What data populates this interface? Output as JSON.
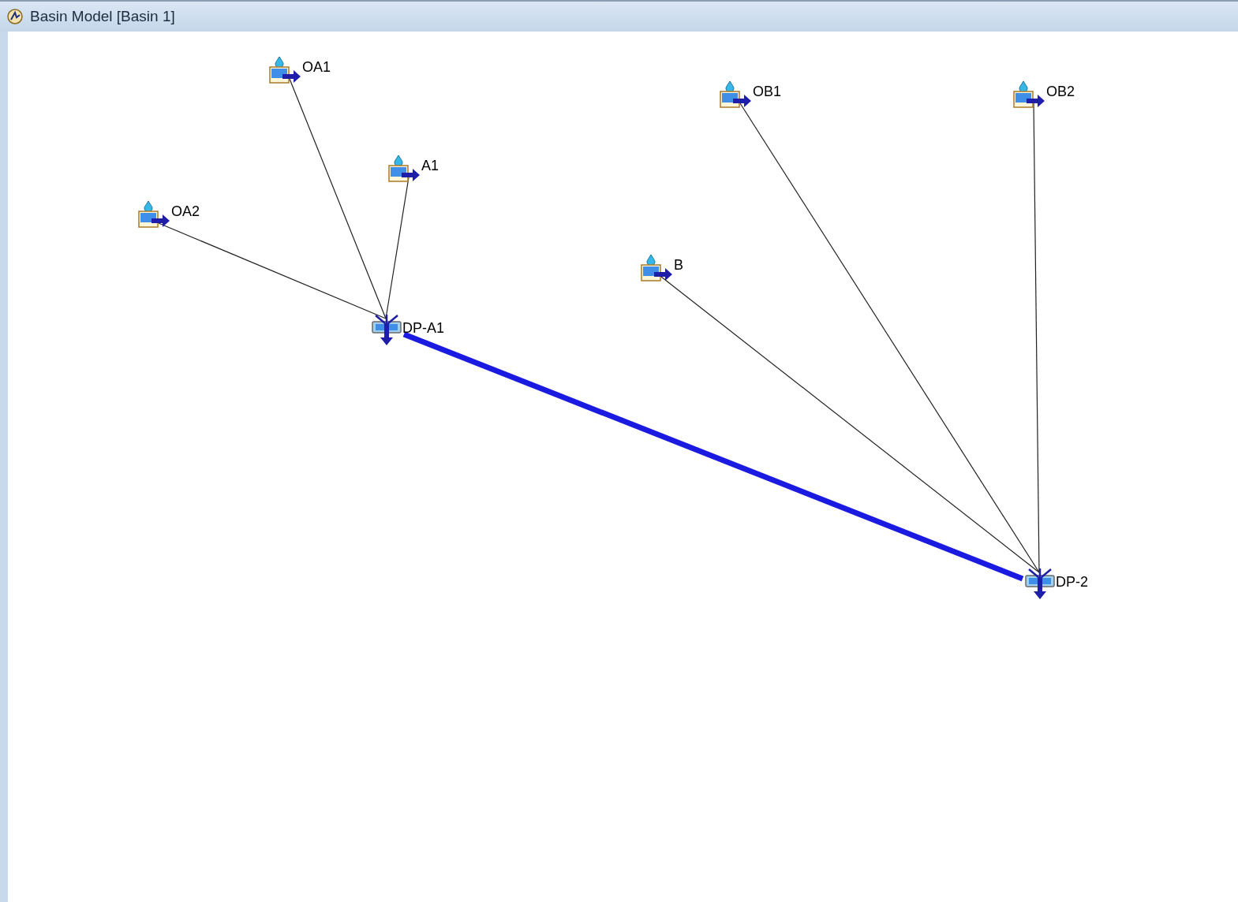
{
  "window": {
    "title": "Basin Model [Basin 1]"
  },
  "nodes": [
    {
      "kind": "subbasin",
      "name": "OA1"
    },
    {
      "kind": "subbasin",
      "name": "A1"
    },
    {
      "kind": "subbasin",
      "name": "OA2"
    },
    {
      "kind": "subbasin",
      "name": "OB1"
    },
    {
      "kind": "subbasin",
      "name": "OB2"
    },
    {
      "kind": "subbasin",
      "name": "B"
    },
    {
      "kind": "junction",
      "name": "DP-A1"
    },
    {
      "kind": "junction",
      "name": "DP-2"
    }
  ]
}
